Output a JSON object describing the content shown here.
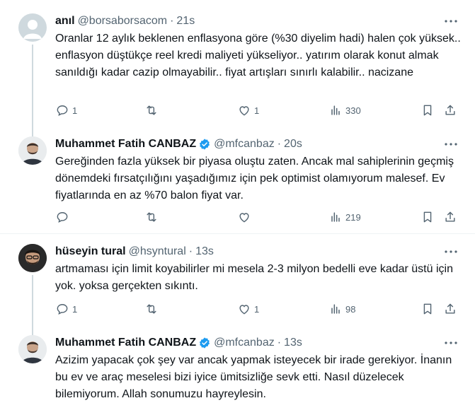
{
  "colors": {
    "text": "#0f1419",
    "secondary": "#536471",
    "verified": "#1d9bf0",
    "thread_line": "#cfd9de",
    "divider": "#eff3f4"
  },
  "tweets": [
    {
      "name": "anıl",
      "handle": "@borsaborsacom",
      "time": "21s",
      "verified": false,
      "avatar": "default-avatar-icon",
      "text": "Oranlar 12 aylık beklenen enflasyona göre (%30 diyelim hadi) halen çok yüksek.. enflasyon düştükçe reel kredi maliyeti yükseliyor.. yatırım olarak konut almak sanıldığı kadar cazip olmayabilir.. fiyat artışları sınırlı kalabilir.. nacizane",
      "replies": "1",
      "reposts": "",
      "likes": "1",
      "views": "330"
    },
    {
      "name": "Muhammet Fatih CANBAZ",
      "handle": "@mfcanbaz",
      "time": "20s",
      "verified": true,
      "avatar": "profile-photo",
      "text": "Gereğinden fazla yüksek bir piyasa oluştu zaten. Ancak mal sahiplerinin geçmiş dönemdeki fırsatçılığını yaşadığımız için pek optimist olamıyorum malesef. Ev fiyatlarında en az %70 balon fiyat var.",
      "replies": "",
      "reposts": "",
      "likes": "",
      "views": "219"
    },
    {
      "name": "hüseyin tural",
      "handle": "@hsyntural",
      "time": "13s",
      "verified": false,
      "avatar": "profile-photo",
      "text": "artmaması için limit koyabilirler mi mesela 2-3 milyon bedelli eve kadar üstü için yok. yoksa gerçekten sıkıntı.",
      "replies": "1",
      "reposts": "",
      "likes": "1",
      "views": "98"
    },
    {
      "name": "Muhammet Fatih CANBAZ",
      "handle": "@mfcanbaz",
      "time": "13s",
      "verified": true,
      "avatar": "profile-photo",
      "text": "Azizim yapacak çok şey var ancak yapmak isteyecek bir irade gerekiyor. İnanın bu ev ve araç meselesi bizi iyice ümitsizliğe sevk etti. Nasıl düzelecek bilemiyorum. Allah sonumuzu hayreylesin."
    }
  ]
}
